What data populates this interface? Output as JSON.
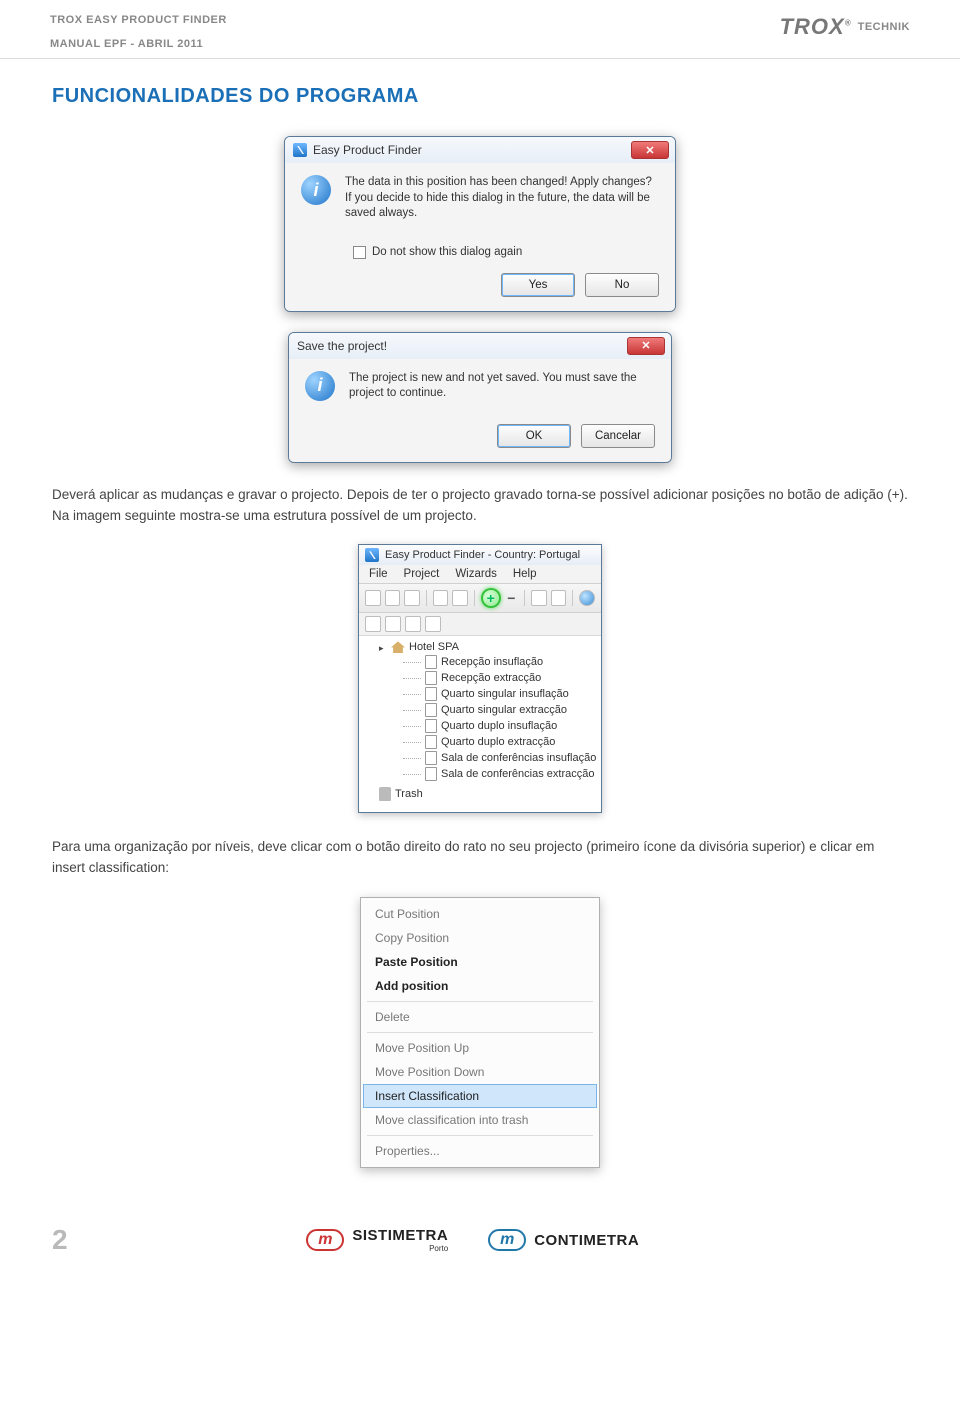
{
  "header": {
    "title": "TROX EASY PRODUCT FINDER",
    "subtitle": "MANUAL EPF - ABRIL 2011",
    "brand_main": "TROX",
    "brand_r": "®",
    "brand_sub": "TECHNIK"
  },
  "section_title": "FUNCIONALIDADES DO PROGRAMA",
  "dialog1": {
    "title": "Easy Product Finder",
    "message": "The data in this position has been changed! Apply changes? If you decide to hide this dialog in the future, the data will be saved always.",
    "checkbox_label": "Do not show this dialog again",
    "yes": "Yes",
    "no": "No",
    "close_glyph": "✕"
  },
  "dialog2": {
    "title": "Save the project!",
    "message": "The project is new and not yet saved. You must save the project to continue.",
    "ok": "OK",
    "cancel": "Cancelar",
    "close_glyph": "✕"
  },
  "paragraph1": "Deverá aplicar as mudanças e gravar o projecto. Depois de ter o projecto gravado torna-se possível adicionar posições no botão de adição (+). Na imagem seguinte mostra-se uma estrutura possível de um projecto.",
  "app": {
    "title": "Easy Product Finder - Country: Portugal",
    "menus": [
      "File",
      "Project",
      "Wizards",
      "Help"
    ],
    "tree_root": "Hotel SPA",
    "tree_items": [
      "Recepção insuflação",
      "Recepção extracção",
      "Quarto singular insuflação",
      "Quarto singular extracção",
      "Quarto duplo insuflação",
      "Quarto duplo extracção",
      "Sala de conferências insuflação",
      "Sala de conferências extracção"
    ],
    "trash": "Trash"
  },
  "paragraph2": "Para uma organização por níveis, deve clicar com o botão direito do rato no seu projecto (primeiro ícone da divisória superior) e clicar em insert classification:",
  "ctx": {
    "items": [
      {
        "label": "Cut Position",
        "state": "disabled"
      },
      {
        "label": "Copy Position",
        "state": "disabled"
      },
      {
        "label": "Paste Position",
        "state": "enabled"
      },
      {
        "label": "Add position",
        "state": "enabled"
      },
      {
        "sep": true
      },
      {
        "label": "Delete",
        "state": "disabled"
      },
      {
        "sep": true
      },
      {
        "label": "Move Position Up",
        "state": "disabled"
      },
      {
        "label": "Move Position Down",
        "state": "disabled"
      },
      {
        "label": "Insert Classification",
        "state": "highlight"
      },
      {
        "label": "Move classification into trash",
        "state": "disabled"
      },
      {
        "sep": true
      },
      {
        "label": "Properties...",
        "state": "disabled"
      }
    ]
  },
  "footer": {
    "page": "2",
    "brand1": "SISTIMETRA",
    "brand1_sub": "Porto",
    "brand2": "CONTIMETRA"
  }
}
